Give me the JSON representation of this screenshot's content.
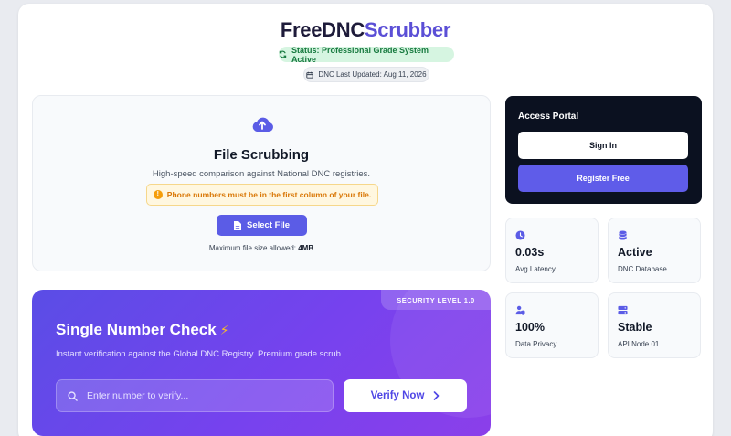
{
  "header": {
    "brand_part1": "FreeDNC",
    "brand_part2": "Scrubber",
    "status": "Status: Professional Grade System Active",
    "dnc_updated": "DNC Last Updated: Aug 11, 2026"
  },
  "upload": {
    "title": "File Scrubbing",
    "description": "High-speed comparison against National DNC registries.",
    "warning": "Phone numbers must be in the first column of your file.",
    "select_label": "Select File",
    "max_size_label": "Maximum file size allowed:",
    "max_size_value": "4MB"
  },
  "single_check": {
    "badge": "SECURITY LEVEL 1.0",
    "title": "Single Number Check",
    "description": "Instant verification against the Global DNC Registry. Premium grade scrub.",
    "input_placeholder": "Enter number to verify...",
    "verify_label": "Verify Now"
  },
  "portal": {
    "title": "Access Portal",
    "signin_label": "Sign In",
    "register_label": "Register Free"
  },
  "stats": [
    {
      "icon": "clock-icon",
      "value": "0.03s",
      "label": "Avg Latency"
    },
    {
      "icon": "database-icon",
      "value": "Active",
      "label": "DNC Database"
    },
    {
      "icon": "user-shield-icon",
      "value": "100%",
      "label": "Data Privacy"
    },
    {
      "icon": "server-icon",
      "value": "Stable",
      "label": "API Node 01"
    }
  ],
  "colors": {
    "accent": "#5b5ce6",
    "status_green": "#177a3f",
    "warning": "#d97706",
    "portal_bg": "#0b1120"
  }
}
